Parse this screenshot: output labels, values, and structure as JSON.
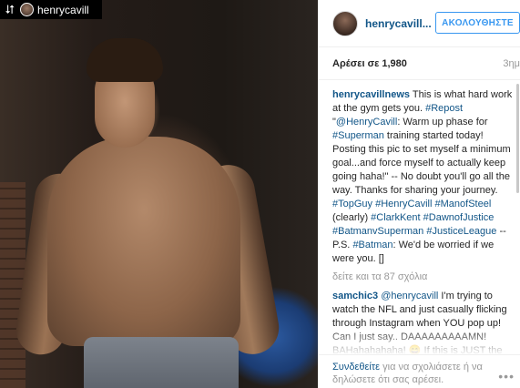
{
  "repost": {
    "username": "henrycavill"
  },
  "post": {
    "username": "henrycavill...",
    "follow_label": "ΑΚΟΛΟΥΘΗΣΤΕ",
    "likes": "Αρέσει σε 1,980",
    "time": "3ημ"
  },
  "comments": [
    {
      "user": "henrycavillnews",
      "segments": [
        {
          "t": "This is what hard work at the gym gets you. "
        },
        {
          "t": "#Repost",
          "link": true
        },
        {
          "t": " \""
        },
        {
          "t": "@HenryCavill",
          "link": true
        },
        {
          "t": ": Warm up phase for "
        },
        {
          "t": "#Superman",
          "link": true
        },
        {
          "t": " training started today! Posting this pic to set myself a minimum goal...and force myself to actually keep going haha!\" -- No doubt you'll go all the way. Thanks for sharing your journey. "
        },
        {
          "t": "#TopGuy",
          "link": true
        },
        {
          "t": " "
        },
        {
          "t": "#HenryCavill",
          "link": true
        },
        {
          "t": " "
        },
        {
          "t": "#ManofSteel",
          "link": true
        },
        {
          "t": " (clearly) "
        },
        {
          "t": "#ClarkKent",
          "link": true
        },
        {
          "t": " "
        },
        {
          "t": "#DawnofJustice",
          "link": true
        },
        {
          "t": " "
        },
        {
          "t": "#BatmanvSuperman",
          "link": true
        },
        {
          "t": " "
        },
        {
          "t": "#JusticeLeague",
          "link": true
        },
        {
          "t": " -- P.S. "
        },
        {
          "t": "#Batman",
          "link": true
        },
        {
          "t": ": We'd be worried if we were you. []"
        }
      ]
    },
    {
      "user": "samchic3",
      "segments": [
        {
          "t": "@henrycavill",
          "link": true
        },
        {
          "t": " I'm trying to watch the NFL and just casually flicking through Instagram when YOU pop up! Can I just say.. DAAAAAAAAAMN! BAHahahahaha! 😄 If this is JUST the \"warm up\" look...man! Hope you don't get too ripped. Even on your 'Off Days' ..."
        }
      ]
    }
  ],
  "more_comments": "δείτε και τα 87 σχόλια",
  "footer": {
    "login": "Συνδεθείτε",
    "rest": " για να σχολιάσετε ή να δηλώσετε ότι σας αρέσει."
  },
  "icons": {
    "repost": "repost-icon",
    "more": "more-options-icon"
  },
  "colors": {
    "link": "#125688",
    "follow": "#3897f0",
    "muted": "#999999"
  }
}
